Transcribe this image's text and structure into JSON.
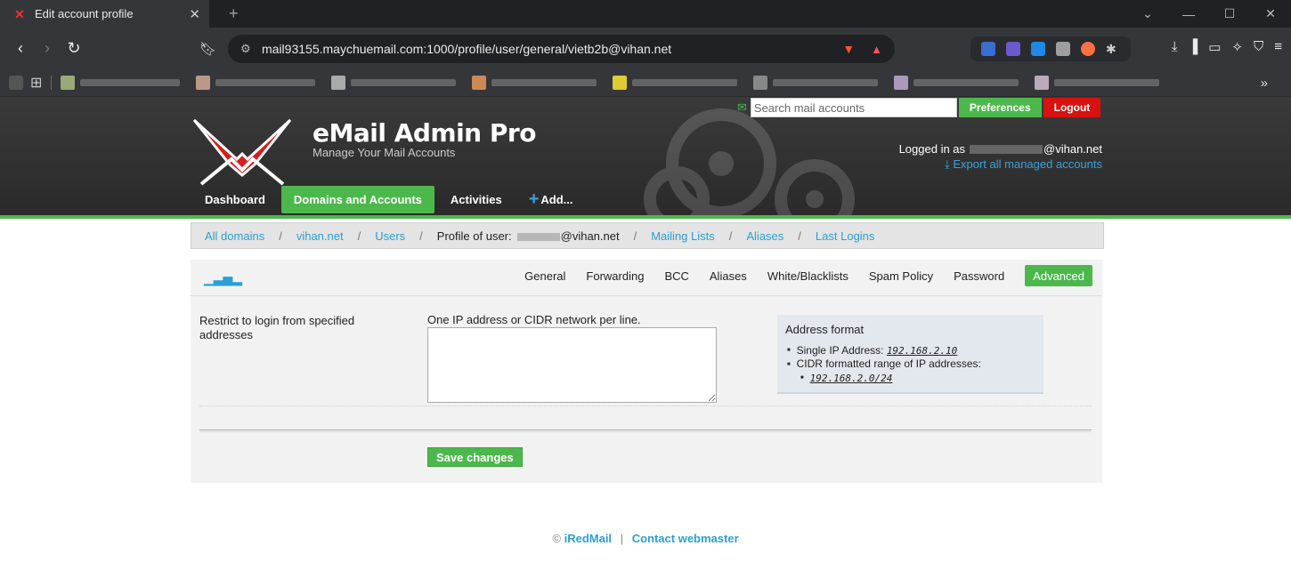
{
  "browser": {
    "tab_title": "Edit account profile",
    "url": "mail93155.maychuemail.com:1000/profile/user/general/vietb2b@vihan.net"
  },
  "header": {
    "brand_title": "eMail Admin Pro",
    "brand_subtitle": "Manage Your Mail Accounts",
    "search_placeholder": "Search mail accounts",
    "preferences_label": "Preferences",
    "logout_label": "Logout",
    "logged_in_prefix": "Logged in as",
    "logged_in_domain": "@vihan.net",
    "export_label": "Export all managed accounts",
    "nav": [
      {
        "label": "Dashboard"
      },
      {
        "label": "Domains and Accounts"
      },
      {
        "label": "Activities"
      },
      {
        "label": "Add..."
      }
    ]
  },
  "breadcrumb": {
    "all_domains": "All domains",
    "domain": "vihan.net",
    "users": "Users",
    "profile_prefix": "Profile of user:",
    "profile_domain": "@vihan.net",
    "mailing_lists": "Mailing Lists",
    "aliases": "Aliases",
    "last_logins": "Last Logins",
    "separator": "/"
  },
  "tabs": [
    "General",
    "Forwarding",
    "BCC",
    "Aliases",
    "White/Blacklists",
    "Spam Policy",
    "Password",
    "Advanced"
  ],
  "form": {
    "label": "Restrict to login from specified addresses",
    "hint": "One IP address or CIDR network per line.",
    "textarea_value": "",
    "save_label": "Save changes"
  },
  "infobox": {
    "title": "Address format",
    "single_label": "Single IP Address:",
    "single_example": "192.168.2.10",
    "cidr_label": "CIDR formatted range of IP addresses:",
    "cidr_example": "192.168.2.0/24"
  },
  "footer": {
    "copyright": "©",
    "iredmail": "iRedMail",
    "pipe": "|",
    "contact": "Contact webmaster"
  },
  "colors": {
    "accent_green": "#4cb84c",
    "logout_red": "#d81111",
    "link_blue": "#2a9fd6"
  }
}
